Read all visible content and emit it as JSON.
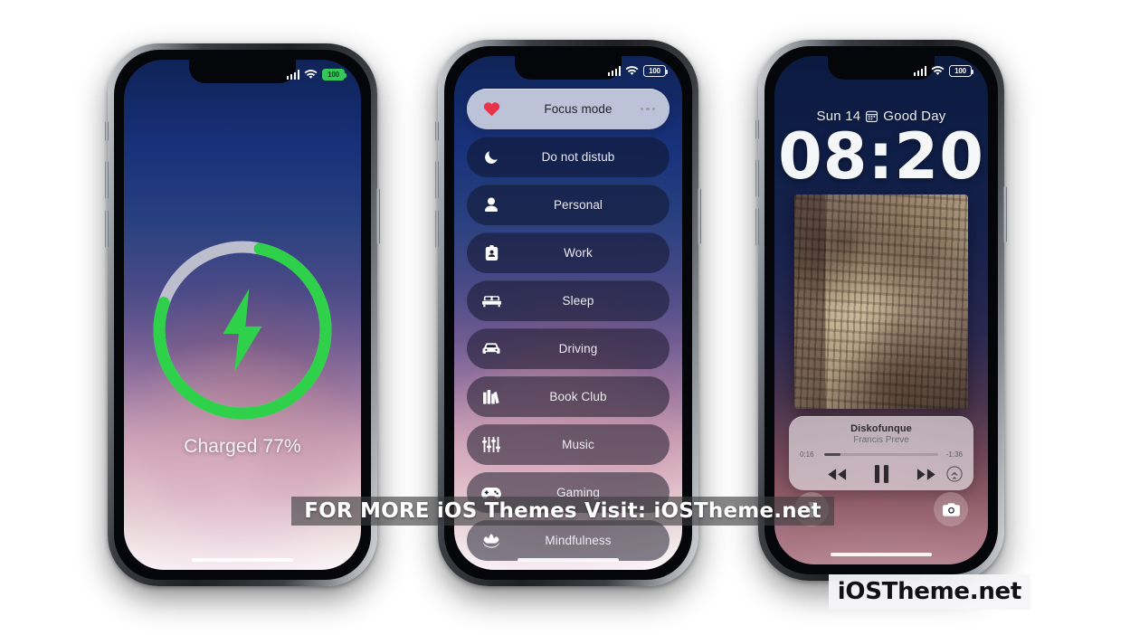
{
  "page": {
    "banner_text": "FOR MORE iOS Themes Visit: iOSTheme.net",
    "logo_text": "iOSTheme.net"
  },
  "colors": {
    "charge_green": "#2fd04a",
    "charge_track": "#c8c9d4",
    "heart_red": "#e8344a",
    "battery_green": "#34c759",
    "wallpaper_top": "#0f2357",
    "wallpaper_mid": "#9d7aa3",
    "wallpaper_bottom": "#ffffff"
  },
  "phone1": {
    "status": {
      "signal_icon": "cellular-bars-icon",
      "wifi_icon": "wifi-icon",
      "battery_level": "100",
      "battery_style": "charging-green"
    },
    "charging": {
      "percent": 77,
      "bolt_icon": "lightning-bolt-icon",
      "label": "Charged 77%"
    }
  },
  "phone2": {
    "status": {
      "signal_icon": "cellular-bars-icon",
      "wifi_icon": "wifi-icon",
      "battery_level": "100",
      "battery_style": "outline"
    },
    "focus_rows": [
      {
        "label": "Focus mode",
        "icon": "heart-icon",
        "active": true,
        "menu_icon": "ellipsis-icon"
      },
      {
        "label": "Do not distub",
        "icon": "moon-crescent-icon",
        "active": false
      },
      {
        "label": "Personal",
        "icon": "person-icon",
        "active": false
      },
      {
        "label": "Work",
        "icon": "id-badge-icon",
        "active": false
      },
      {
        "label": "Sleep",
        "icon": "bed-icon",
        "active": false
      },
      {
        "label": "Driving",
        "icon": "car-icon",
        "active": false
      },
      {
        "label": "Book Club",
        "icon": "books-icon",
        "active": false
      },
      {
        "label": "Music",
        "icon": "equalizer-sliders-icon",
        "active": false
      },
      {
        "label": "Gaming",
        "icon": "game-controller-icon",
        "active": false
      },
      {
        "label": "Mindfulness",
        "icon": "lotus-icon",
        "active": false
      }
    ]
  },
  "phone3": {
    "status": {
      "signal_icon": "cellular-bars-icon",
      "wifi_icon": "wifi-icon",
      "battery_level": "100",
      "battery_style": "outline"
    },
    "lock": {
      "date": "Sun 14",
      "calendar_icon": "calendar-icon",
      "greeting": "Good Day",
      "time": "08:20"
    },
    "player": {
      "title": "Diskofunque",
      "artist": "Francis Preve",
      "elapsed": "0:16",
      "remaining": "-1:36",
      "progress_percent": 14,
      "rewind_icon": "rewind-icon",
      "pause_icon": "pause-icon",
      "forward_icon": "fast-forward-icon",
      "airplay_icon": "airplay-icon"
    },
    "shortcuts": {
      "flashlight_icon": "flashlight-icon",
      "camera_icon": "camera-icon"
    }
  }
}
